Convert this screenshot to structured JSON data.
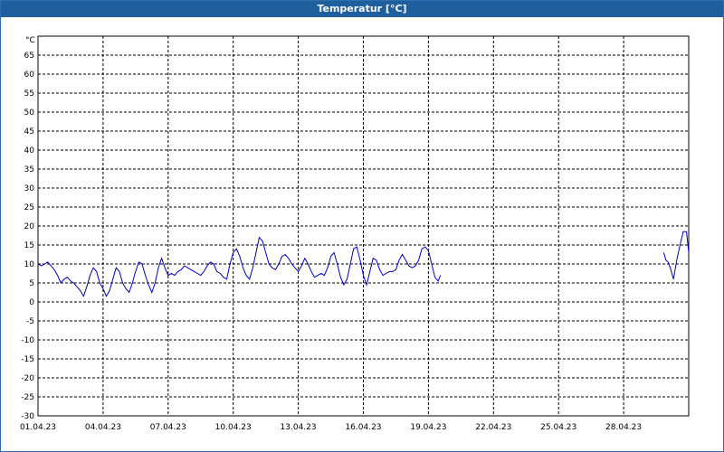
{
  "window": {
    "title": "Temperatur [°C]"
  },
  "chart_data": {
    "type": "line",
    "title": "Temperatur [°C]",
    "ylabel": "°C",
    "xlabel": "",
    "ylim": [
      -30,
      70
    ],
    "y_ticks": [
      65,
      60,
      55,
      50,
      45,
      40,
      35,
      30,
      25,
      20,
      15,
      10,
      5,
      0,
      -5,
      -10,
      -15,
      -20,
      -25,
      -30
    ],
    "x_ticks": [
      "01.04.23",
      "04.04.23",
      "07.04.23",
      "10.04.23",
      "13.04.23",
      "16.04.23",
      "19.04.23",
      "22.04.23",
      "25.04.23",
      "28.04.23"
    ],
    "x_range_days": [
      0,
      30
    ],
    "grid": true,
    "line_color": "#0000c0",
    "series": [
      {
        "segments": [
          [
            [
              0.0,
              10.0
            ],
            [
              0.15,
              9.5
            ],
            [
              0.3,
              10.0
            ],
            [
              0.45,
              10.5
            ],
            [
              0.6,
              9.5
            ],
            [
              0.75,
              8.5
            ],
            [
              0.9,
              7.0
            ],
            [
              1.05,
              5.0
            ],
            [
              1.2,
              6.0
            ],
            [
              1.35,
              6.5
            ],
            [
              1.5,
              5.5
            ],
            [
              1.65,
              5.0
            ],
            [
              1.8,
              4.0
            ],
            [
              1.95,
              3.0
            ],
            [
              2.1,
              1.5
            ],
            [
              2.25,
              4.0
            ],
            [
              2.4,
              7.0
            ],
            [
              2.55,
              9.0
            ],
            [
              2.7,
              8.0
            ],
            [
              2.85,
              5.0
            ],
            [
              3.0,
              3.5
            ],
            [
              3.15,
              1.5
            ],
            [
              3.3,
              3.0
            ],
            [
              3.45,
              6.0
            ],
            [
              3.6,
              9.0
            ],
            [
              3.75,
              8.0
            ],
            [
              3.9,
              5.0
            ],
            [
              4.05,
              3.5
            ],
            [
              4.2,
              2.5
            ],
            [
              4.35,
              5.0
            ],
            [
              4.5,
              8.0
            ],
            [
              4.65,
              10.5
            ],
            [
              4.8,
              10.0
            ],
            [
              4.95,
              7.0
            ],
            [
              5.1,
              4.5
            ],
            [
              5.25,
              2.5
            ],
            [
              5.4,
              5.0
            ],
            [
              5.55,
              9.0
            ],
            [
              5.7,
              11.5
            ],
            [
              5.85,
              9.0
            ],
            [
              6.0,
              7.0
            ],
            [
              6.15,
              7.5
            ],
            [
              6.3,
              7.0
            ],
            [
              6.45,
              8.0
            ],
            [
              6.6,
              8.5
            ],
            [
              6.75,
              9.5
            ],
            [
              6.9,
              9.0
            ],
            [
              7.05,
              8.5
            ],
            [
              7.2,
              8.0
            ],
            [
              7.35,
              7.5
            ],
            [
              7.5,
              7.0
            ],
            [
              7.65,
              8.0
            ],
            [
              7.8,
              9.5
            ],
            [
              7.95,
              10.5
            ],
            [
              8.1,
              10.0
            ],
            [
              8.25,
              8.0
            ],
            [
              8.4,
              7.5
            ],
            [
              8.55,
              6.5
            ],
            [
              8.7,
              6.0
            ],
            [
              8.85,
              10.0
            ],
            [
              9.0,
              13.0
            ],
            [
              9.15,
              14.0
            ],
            [
              9.3,
              12.0
            ],
            [
              9.45,
              9.0
            ],
            [
              9.6,
              7.0
            ],
            [
              9.75,
              6.0
            ],
            [
              9.9,
              9.0
            ],
            [
              10.05,
              13.0
            ],
            [
              10.2,
              17.0
            ],
            [
              10.35,
              16.0
            ],
            [
              10.5,
              13.0
            ],
            [
              10.65,
              10.0
            ],
            [
              10.8,
              9.0
            ],
            [
              10.95,
              8.5
            ],
            [
              11.1,
              10.0
            ],
            [
              11.25,
              12.0
            ],
            [
              11.4,
              12.5
            ],
            [
              11.55,
              11.5
            ],
            [
              11.7,
              10.0
            ],
            [
              11.85,
              9.0
            ],
            [
              12.0,
              8.0
            ],
            [
              12.15,
              9.5
            ],
            [
              12.3,
              11.5
            ],
            [
              12.45,
              10.0
            ],
            [
              12.6,
              8.0
            ],
            [
              12.75,
              6.5
            ],
            [
              12.9,
              7.0
            ],
            [
              13.05,
              7.5
            ],
            [
              13.2,
              7.0
            ],
            [
              13.35,
              9.0
            ],
            [
              13.5,
              12.0
            ],
            [
              13.65,
              13.0
            ],
            [
              13.8,
              10.0
            ],
            [
              13.95,
              6.5
            ],
            [
              14.1,
              4.5
            ],
            [
              14.25,
              6.0
            ],
            [
              14.4,
              10.0
            ],
            [
              14.55,
              14.0
            ],
            [
              14.7,
              14.5
            ],
            [
              14.85,
              11.0
            ],
            [
              15.0,
              7.0
            ],
            [
              15.15,
              4.5
            ],
            [
              15.3,
              8.0
            ],
            [
              15.45,
              11.5
            ],
            [
              15.6,
              11.0
            ],
            [
              15.75,
              8.5
            ],
            [
              15.9,
              7.0
            ],
            [
              16.05,
              7.5
            ],
            [
              16.2,
              8.0
            ],
            [
              16.35,
              8.0
            ],
            [
              16.5,
              8.5
            ],
            [
              16.65,
              11.0
            ],
            [
              16.8,
              12.5
            ],
            [
              16.95,
              11.0
            ],
            [
              17.1,
              9.5
            ],
            [
              17.25,
              9.0
            ],
            [
              17.4,
              9.5
            ],
            [
              17.55,
              11.0
            ],
            [
              17.7,
              14.0
            ],
            [
              17.85,
              14.5
            ],
            [
              18.0,
              13.5
            ],
            [
              18.15,
              10.0
            ],
            [
              18.3,
              6.5
            ],
            [
              18.45,
              5.5
            ],
            [
              18.55,
              7.0
            ]
          ],
          [
            [
              28.85,
              13.0
            ],
            [
              28.95,
              11.0
            ],
            [
              29.05,
              10.5
            ],
            [
              29.15,
              9.0
            ],
            [
              29.3,
              6.0
            ],
            [
              29.45,
              11.0
            ],
            [
              29.6,
              15.0
            ],
            [
              29.75,
              18.5
            ],
            [
              29.9,
              18.5
            ],
            [
              30.0,
              13.0
            ]
          ]
        ]
      }
    ]
  }
}
